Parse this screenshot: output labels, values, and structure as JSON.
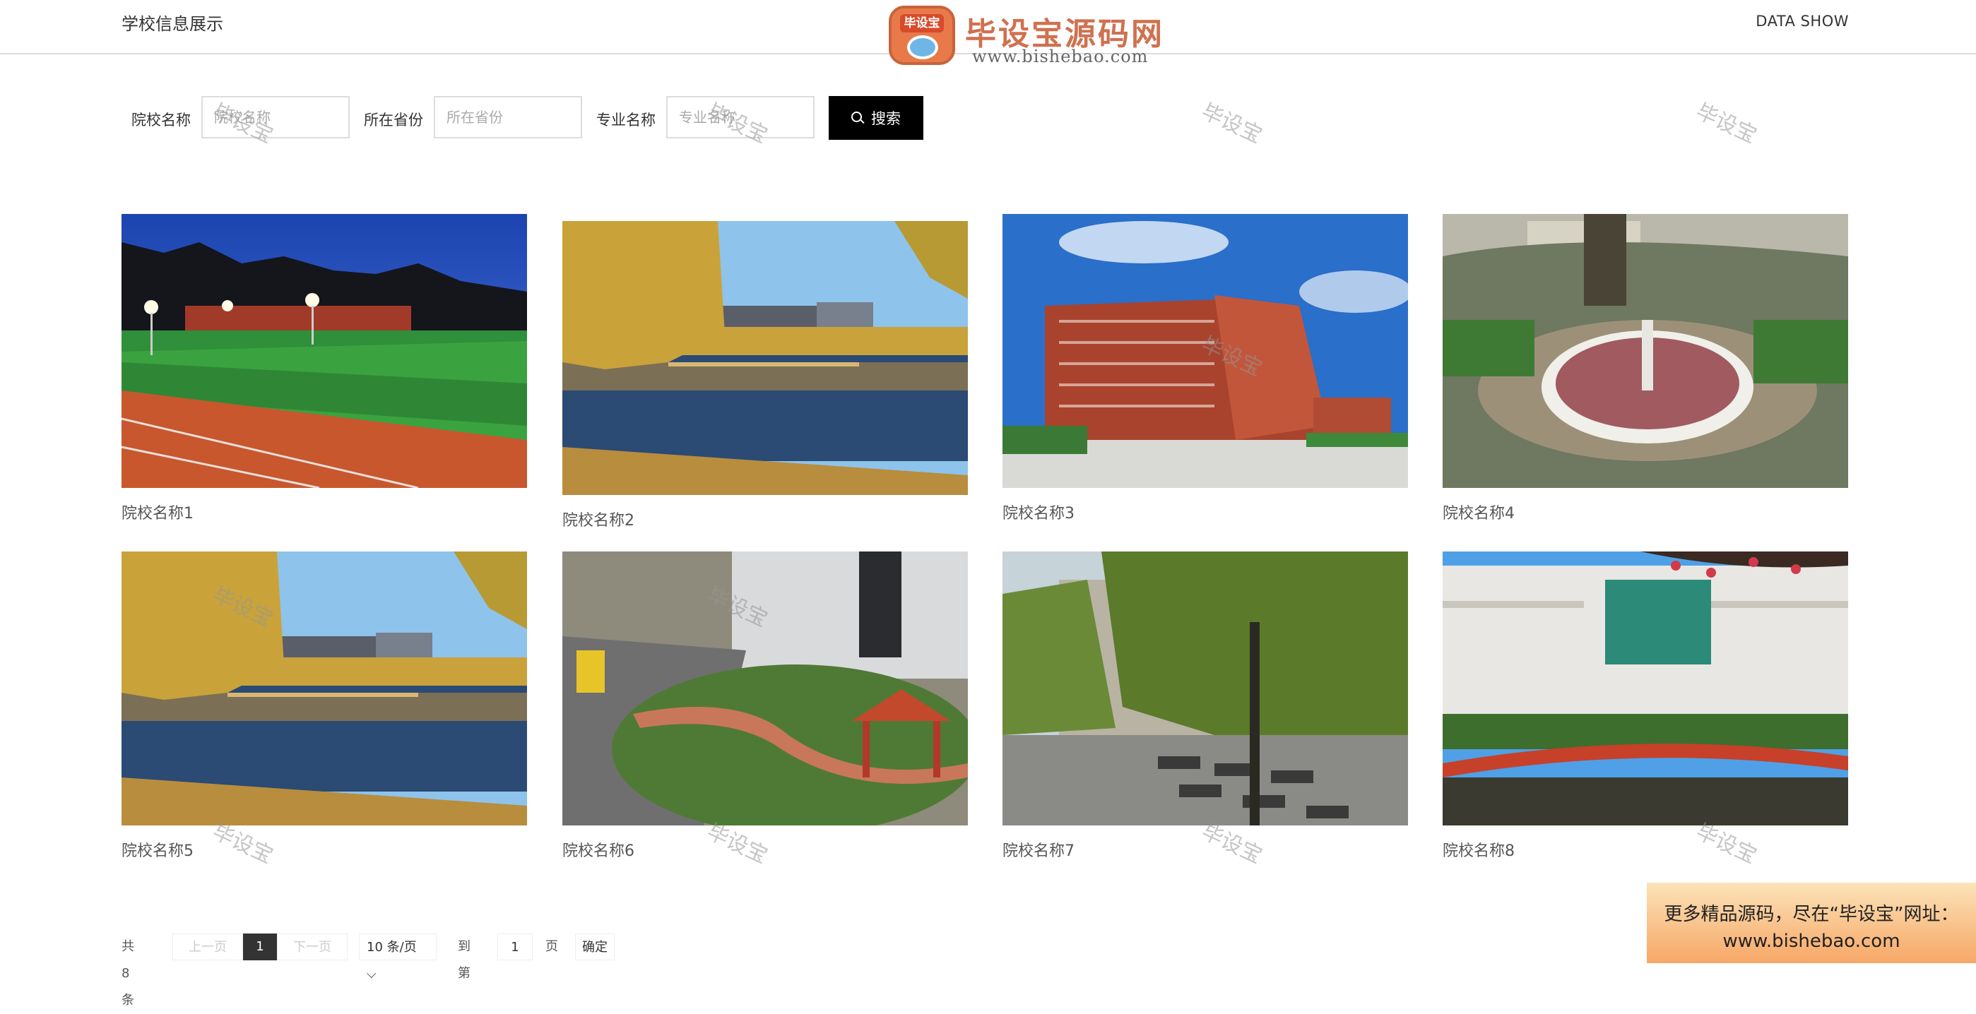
{
  "header": {
    "title": "学校信息展示",
    "right_link": "DATA SHOW"
  },
  "brand": {
    "badge_text": "毕设宝",
    "name": "毕设宝源码网",
    "url": "www.bishebao.com"
  },
  "search": {
    "school_label": "院校名称",
    "school_placeholder": "院校名称",
    "province_label": "所在省份",
    "province_placeholder": "所在省份",
    "major_label": "专业名称",
    "major_placeholder": "专业名称",
    "button_label": "搜索"
  },
  "cards": [
    {
      "name": "院校名称1"
    },
    {
      "name": "院校名称2"
    },
    {
      "name": "院校名称3"
    },
    {
      "name": "院校名称4"
    },
    {
      "name": "院校名称5"
    },
    {
      "name": "院校名称6"
    },
    {
      "name": "院校名称7"
    },
    {
      "name": "院校名称8"
    }
  ],
  "pagination": {
    "total": "共 8 条",
    "prev": "上一页",
    "current_page": "1",
    "next": "下一页",
    "page_size": "10 条/页",
    "goto_label": "到第",
    "goto_value": "1",
    "page_unit": "页",
    "confirm": "确定"
  },
  "watermark": "毕设宝",
  "promo": {
    "line1": "更多精品源码，尽在“毕设宝”网址：",
    "line2": "www.bishebao.com"
  },
  "colors": {
    "search_button": "#000000",
    "brand": "#cf7150",
    "pager_current": "#333333"
  }
}
